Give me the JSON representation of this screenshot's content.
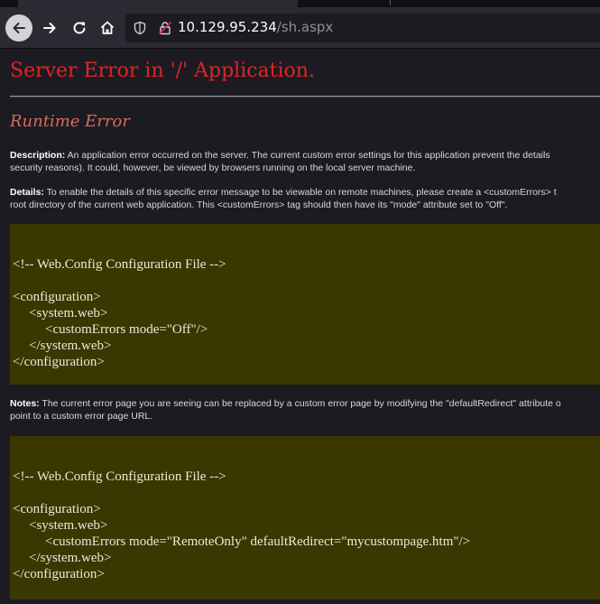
{
  "browser": {
    "url_host": "10.129.95.234",
    "url_path": "/sh.aspx"
  },
  "page": {
    "title": "Server Error in '/' Application.",
    "subtitle": "Runtime Error",
    "description_label": "Description:",
    "description_line1": " An application error occurred on the server. The current custom error settings for this application prevent the details",
    "description_line2": "security reasons). It could, however, be viewed by browsers running on the local server machine.",
    "details_label": "Details:",
    "details_line1": " To enable the details of this specific error message to be viewable on remote machines, please create a <customErrors> t",
    "details_line2": "root directory of the current web application. This <customErrors> tag should then have its \"mode\" attribute set to \"Off\".",
    "notes_label": "Notes:",
    "notes_line1": " The current error page you are seeing can be replaced by a custom error page by modifying the \"defaultRedirect\" attribute o",
    "notes_line2": "point to a custom error page URL.",
    "code1": {
      "comment": "<!-- Web.Config Configuration File -->",
      "open_config": "<configuration>",
      "open_sysweb": "<system.web>",
      "custom_errors": "<customErrors mode=\"Off\"/>",
      "close_sysweb": "</system.web>",
      "close_config": "</configuration>"
    },
    "code2": {
      "comment": "<!-- Web.Config Configuration File -->",
      "open_config": "<configuration>",
      "open_sysweb": "<system.web>",
      "custom_errors": "<customErrors mode=\"RemoteOnly\" defaultRedirect=\"mycustompage.htm\"/>",
      "close_sysweb": "</system.web>",
      "close_config": "</configuration>"
    }
  },
  "colors": {
    "title": "#e02424",
    "subtitle": "#d76a5f",
    "code_bg": "#3b3700",
    "page_bg": "#1c1b22"
  }
}
